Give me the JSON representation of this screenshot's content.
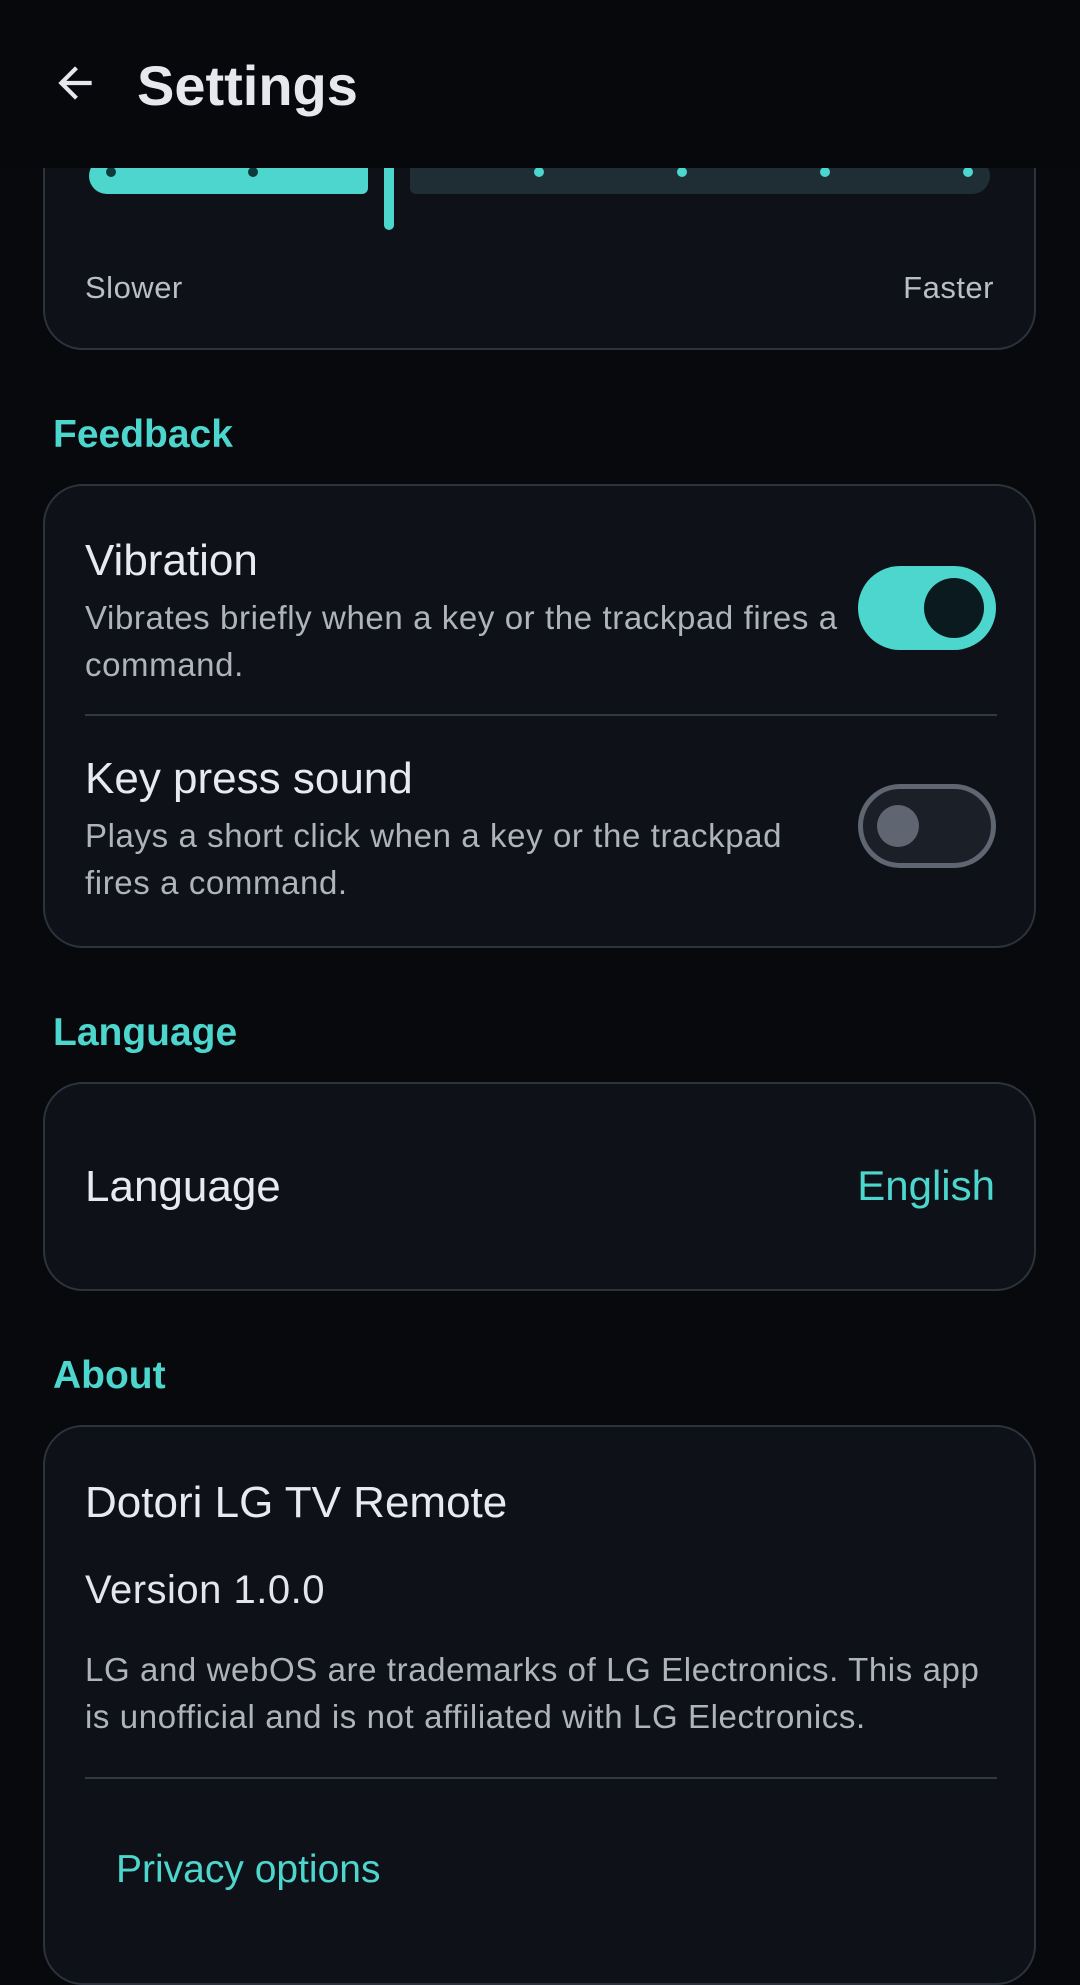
{
  "app_bar": {
    "title": "Settings",
    "back_icon": "arrow-back-icon"
  },
  "speed": {
    "min_label": "Slower",
    "max_label": "Faster",
    "level_fraction": 0.25
  },
  "feedback": {
    "section_title": "Feedback",
    "vibration": {
      "title": "Vibration",
      "description": "Vibrates briefly when a key or the trackpad fires a command.",
      "enabled": true
    },
    "key_press_sound": {
      "title": "Key press sound",
      "description": "Plays a short click when a key or the trackpad fires a command.",
      "enabled": false
    }
  },
  "language": {
    "section_title": "Language",
    "label": "Language",
    "value": "English"
  },
  "about": {
    "section_title": "About",
    "app_name": "Dotori LG TV Remote",
    "version": "Version 1.0.0",
    "legal": "LG and webOS are trademarks of LG Electronics. This app is unofficial and is not affiliated with LG Electronics.",
    "privacy_link": "Privacy options"
  },
  "colors": {
    "accent": "#4dd6ce",
    "background": "#07090c",
    "card": "#0e1218",
    "card_border": "#2c333d"
  }
}
